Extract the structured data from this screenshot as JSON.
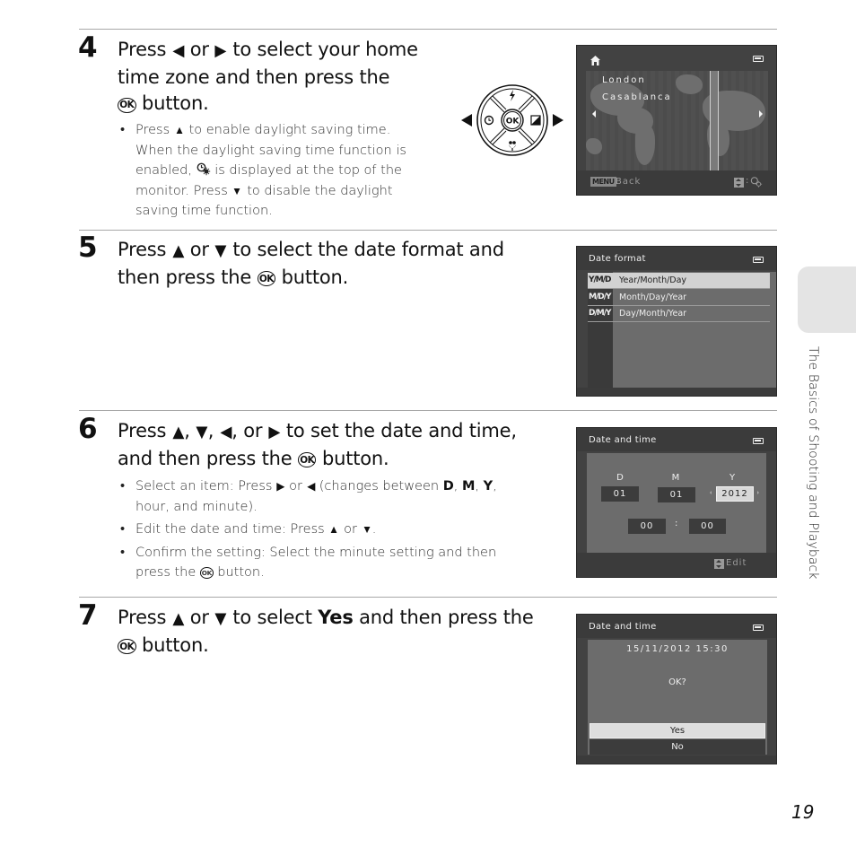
{
  "page": {
    "number": "19",
    "section_tab": "The Basics of Shooting and Playback"
  },
  "steps": [
    {
      "number": "4",
      "title_parts": [
        "Press",
        "or",
        "to select your home",
        "time zone and then press the",
        "button."
      ],
      "bullets": [
        "Press ▲ to enable daylight saving time. When the daylight saving time function is enabled, [DST icon] is displayed at the top of the monitor. Press ▼ to disable the daylight saving time function."
      ],
      "bullet_parts": {
        "b1_a": "Press",
        "b1_b": "to enable daylight saving time.",
        "b1_c": "When the daylight saving time function is",
        "b1_d": "enabled,",
        "b1_e": "is displayed at the top of the",
        "b1_f": "monitor. Press",
        "b1_g": "to disable the daylight",
        "b1_h": "saving time function."
      }
    },
    {
      "number": "5",
      "title_parts": [
        "Press",
        "or",
        "to select the date format and",
        "then press the",
        "button."
      ]
    },
    {
      "number": "6",
      "title_parts": [
        "Press",
        ",",
        ",",
        ", or",
        "to set the date and time,",
        "and then press the",
        "button."
      ],
      "bullet_parts": {
        "b1_a": "Select an item: Press",
        "b1_b": "or",
        "b1_c": "(changes between",
        "b1_D": "D",
        "b1_M": "M",
        "b1_Y": "Y",
        "b1_d": "hour, and minute).",
        "b2_a": "Edit the date and time: Press",
        "b2_b": "or",
        "b3_a": "Confirm the setting: Select the minute setting and then",
        "b3_b": "press the",
        "b3_c": "button."
      }
    },
    {
      "number": "7",
      "title_parts": [
        "Press",
        "or",
        "to select",
        "Yes",
        "and then press the",
        "button."
      ]
    }
  ],
  "glyphs": {
    "left": "◀",
    "right": "▶",
    "up": "▲",
    "down": "▼",
    "ok": "OK",
    "comma": ","
  },
  "dpad": {
    "center_label": "OK",
    "icons": [
      "flash-icon",
      "self-timer-icon",
      "exposure-compensation-icon",
      "macro-icon"
    ]
  },
  "screens": {
    "time_zone": {
      "cities": [
        "London",
        "Casablanca"
      ],
      "footer_menu": "MENU",
      "footer_back": "Back",
      "footer_right": ":"
    },
    "date_format": {
      "title": "Date format",
      "options": [
        {
          "abbr": "Y/M/D",
          "label": "Year/Month/Day",
          "selected": true
        },
        {
          "abbr": "M/D/Y",
          "label": "Month/Day/Year",
          "selected": false
        },
        {
          "abbr": "D/M/Y",
          "label": "Day/Month/Year",
          "selected": false
        }
      ]
    },
    "date_time_edit": {
      "title": "Date and time",
      "labels": {
        "d": "D",
        "m": "M",
        "y": "Y"
      },
      "values": {
        "day": "01",
        "month": "01",
        "year": "2012",
        "hour": "00",
        "minute": "00"
      },
      "colon": ":",
      "footer_edit": "Edit"
    },
    "confirm": {
      "title": "Date and time",
      "datetime": "15/11/2012  15:30",
      "question": "OK?",
      "options": [
        {
          "label": "Yes",
          "selected": true
        },
        {
          "label": "No",
          "selected": false
        }
      ]
    }
  }
}
